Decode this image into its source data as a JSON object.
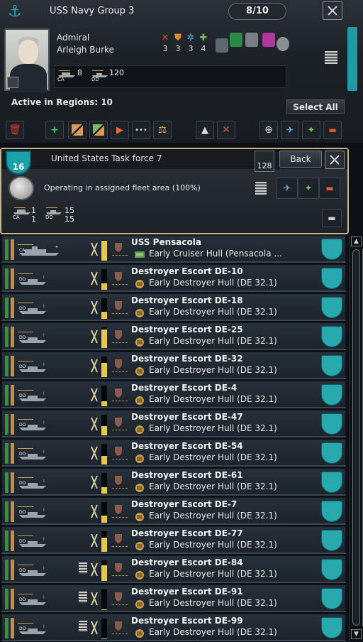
{
  "fleet": {
    "title": "USS Navy Group 3",
    "count": "8/10",
    "admiral_rank": "Admiral",
    "admiral_name": "Arleigh Burke",
    "skills": [
      {
        "icon": "attack-icon",
        "value": "3",
        "color": "#e0483a"
      },
      {
        "icon": "defense-icon",
        "value": "3",
        "color": "#d98a35"
      },
      {
        "icon": "maneuver-icon",
        "value": "3",
        "color": "#5ab0d8"
      },
      {
        "icon": "coordination-icon",
        "value": "4",
        "color": "#6fbf5a"
      }
    ],
    "ship_counts": [
      {
        "type_label": "CA",
        "value": "8"
      },
      {
        "type_label": "DD",
        "value": "120"
      }
    ],
    "active_regions": "Active in Regions: 10",
    "select_all": "Select All"
  },
  "taskforce": {
    "strength": "16",
    "title": "United States Task force 7",
    "count": "128",
    "back": "Back",
    "status": "Operating in assigned fleet area (100%)",
    "ship_counts": [
      {
        "type_label": "CA",
        "a": "1",
        "b": "1"
      },
      {
        "type_label": "DD",
        "a": "15",
        "b": "15"
      }
    ]
  },
  "ships": [
    {
      "name": "USS Pensacola",
      "hull": "Early Cruiser Hull (Pensacola ...",
      "type": "CA",
      "fill": 0.95,
      "book": false
    },
    {
      "name": "Destroyer Escort DE-10",
      "hull": "Early Destroyer Hull (DE 32.1)",
      "type": "DD",
      "fill": 0.3,
      "book": false
    },
    {
      "name": "Destroyer Escort DE-18",
      "hull": "Early Destroyer Hull (DE 32.1)",
      "type": "DD",
      "fill": 0.35,
      "book": false
    },
    {
      "name": "Destroyer Escort DE-25",
      "hull": "Early Destroyer Hull (DE 32.1)",
      "type": "DD",
      "fill": 0.9,
      "book": false
    },
    {
      "name": "Destroyer Escort DE-32",
      "hull": "Early Destroyer Hull (DE 32.1)",
      "type": "DD",
      "fill": 0.7,
      "book": false
    },
    {
      "name": "Destroyer Escort DE-4",
      "hull": "Early Destroyer Hull (DE 32.1)",
      "type": "DD",
      "fill": 0.25,
      "book": false
    },
    {
      "name": "Destroyer Escort DE-47",
      "hull": "Early Destroyer Hull (DE 32.1)",
      "type": "DD",
      "fill": 0.45,
      "book": false
    },
    {
      "name": "Destroyer Escort DE-54",
      "hull": "Early Destroyer Hull (DE 32.1)",
      "type": "DD",
      "fill": 0.4,
      "book": false
    },
    {
      "name": "Destroyer Escort DE-61",
      "hull": "Early Destroyer Hull (DE 32.1)",
      "type": "DD",
      "fill": 0.3,
      "book": false
    },
    {
      "name": "Destroyer Escort DE-7",
      "hull": "Early Destroyer Hull (DE 32.1)",
      "type": "DD",
      "fill": 0.35,
      "book": false
    },
    {
      "name": "Destroyer Escort DE-77",
      "hull": "Early Destroyer Hull (DE 32.1)",
      "type": "DD",
      "fill": 0.7,
      "book": false
    },
    {
      "name": "Destroyer Escort DE-84",
      "hull": "Early Destroyer Hull (DE 32.1)",
      "type": "DD",
      "fill": 0.75,
      "book": true
    },
    {
      "name": "Destroyer Escort DE-91",
      "hull": "Early Destroyer Hull (DE 32.1)",
      "type": "DD",
      "fill": 0.05,
      "book": true
    },
    {
      "name": "Destroyer Escort DE-99",
      "hull": "Early Destroyer Hull (DE 32.1)",
      "type": "DD",
      "fill": 0.05,
      "book": true
    }
  ],
  "colors": {
    "accent": "#27a9ae",
    "border_gold": "#c6b686",
    "strength_bar": "#e8c84a",
    "org_green": "#3b8f3a",
    "org_orange": "#c98a45"
  }
}
